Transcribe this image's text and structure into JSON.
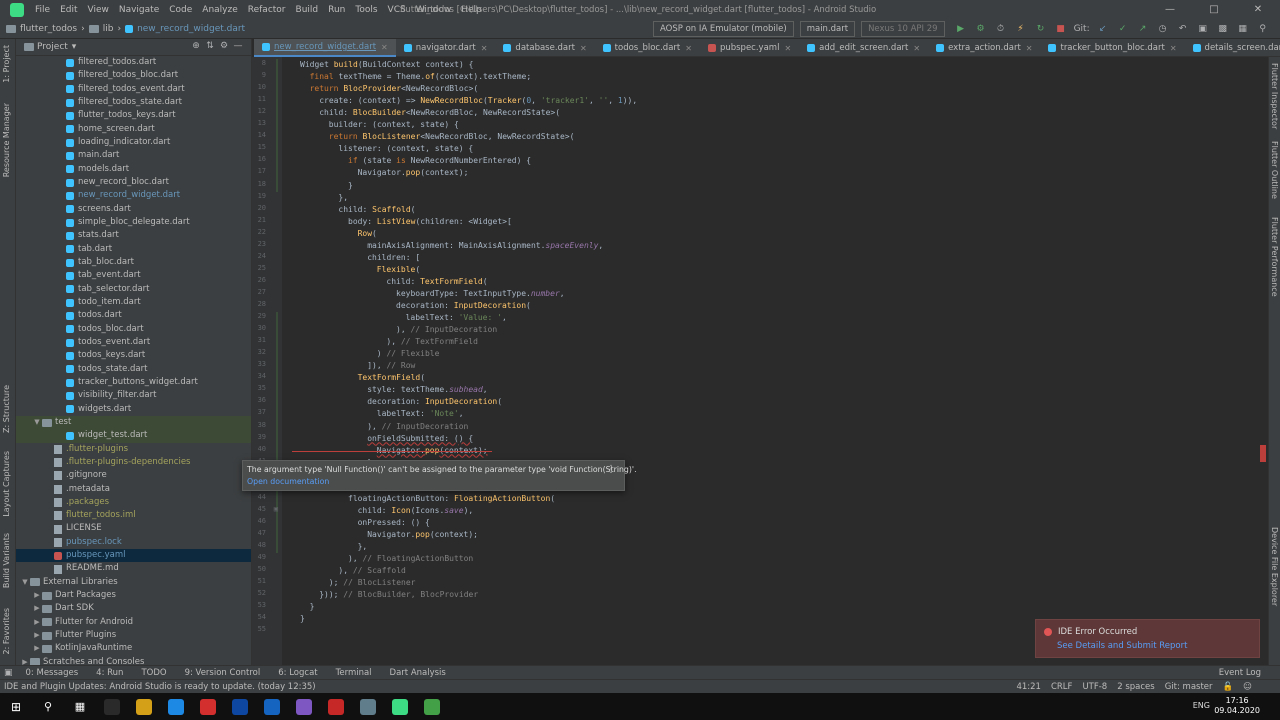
{
  "menubar": {
    "items": [
      "File",
      "Edit",
      "View",
      "Navigate",
      "Code",
      "Analyze",
      "Refactor",
      "Build",
      "Run",
      "Tools",
      "VCS",
      "Window",
      "Help"
    ],
    "title": "flutter_todos [C:\\Users\\PC\\Desktop\\flutter_todos] - ...\\lib\\new_record_widget.dart [flutter_todos] - Android Studio"
  },
  "navbar": {
    "crumbs": [
      "flutter_todos",
      "lib",
      "new_record_widget.dart"
    ],
    "device": "AOSP on IA Emulator (mobile)",
    "config": "main.dart",
    "avd": "Nexus 10 API 29",
    "git_label": "Git:"
  },
  "tabs": [
    {
      "label": "new_record_widget.dart",
      "active": true,
      "kind": "dart"
    },
    {
      "label": "navigator.dart",
      "active": false,
      "kind": "dart"
    },
    {
      "label": "database.dart",
      "active": false,
      "kind": "dart"
    },
    {
      "label": "todos_bloc.dart",
      "active": false,
      "kind": "dart"
    },
    {
      "label": "pubspec.yaml",
      "active": false,
      "kind": "yaml"
    },
    {
      "label": "add_edit_screen.dart",
      "active": false,
      "kind": "dart"
    },
    {
      "label": "extra_action.dart",
      "active": false,
      "kind": "dart"
    },
    {
      "label": "tracker_button_bloc.dart",
      "active": false,
      "kind": "dart"
    },
    {
      "label": "details_screen.dart",
      "active": false,
      "kind": "dart"
    }
  ],
  "project_panel": {
    "title": "Project",
    "tree": [
      {
        "label": "filtered_todos.dart",
        "indent": 3,
        "icon": "dart"
      },
      {
        "label": "filtered_todos_bloc.dart",
        "indent": 3,
        "icon": "dart"
      },
      {
        "label": "filtered_todos_event.dart",
        "indent": 3,
        "icon": "dart"
      },
      {
        "label": "filtered_todos_state.dart",
        "indent": 3,
        "icon": "dart"
      },
      {
        "label": "flutter_todos_keys.dart",
        "indent": 3,
        "icon": "dart"
      },
      {
        "label": "home_screen.dart",
        "indent": 3,
        "icon": "dart"
      },
      {
        "label": "loading_indicator.dart",
        "indent": 3,
        "icon": "dart"
      },
      {
        "label": "main.dart",
        "indent": 3,
        "icon": "dart"
      },
      {
        "label": "models.dart",
        "indent": 3,
        "icon": "dart"
      },
      {
        "label": "new_record_bloc.dart",
        "indent": 3,
        "icon": "dart"
      },
      {
        "label": "new_record_widget.dart",
        "indent": 3,
        "icon": "dart",
        "style": "blue"
      },
      {
        "label": "screens.dart",
        "indent": 3,
        "icon": "dart"
      },
      {
        "label": "simple_bloc_delegate.dart",
        "indent": 3,
        "icon": "dart"
      },
      {
        "label": "stats.dart",
        "indent": 3,
        "icon": "dart"
      },
      {
        "label": "tab.dart",
        "indent": 3,
        "icon": "dart"
      },
      {
        "label": "tab_bloc.dart",
        "indent": 3,
        "icon": "dart"
      },
      {
        "label": "tab_event.dart",
        "indent": 3,
        "icon": "dart"
      },
      {
        "label": "tab_selector.dart",
        "indent": 3,
        "icon": "dart"
      },
      {
        "label": "todo_item.dart",
        "indent": 3,
        "icon": "dart"
      },
      {
        "label": "todos.dart",
        "indent": 3,
        "icon": "dart"
      },
      {
        "label": "todos_bloc.dart",
        "indent": 3,
        "icon": "dart"
      },
      {
        "label": "todos_event.dart",
        "indent": 3,
        "icon": "dart"
      },
      {
        "label": "todos_keys.dart",
        "indent": 3,
        "icon": "dart"
      },
      {
        "label": "todos_state.dart",
        "indent": 3,
        "icon": "dart"
      },
      {
        "label": "tracker_buttons_widget.dart",
        "indent": 3,
        "icon": "dart"
      },
      {
        "label": "visibility_filter.dart",
        "indent": 3,
        "icon": "dart"
      },
      {
        "label": "widgets.dart",
        "indent": 3,
        "icon": "dart"
      },
      {
        "label": "test",
        "indent": 1,
        "icon": "folder",
        "arrow": "▼",
        "style": "test"
      },
      {
        "label": "widget_test.dart",
        "indent": 3,
        "icon": "dart",
        "style": "test"
      },
      {
        "label": ".flutter-plugins",
        "indent": 2,
        "icon": "file",
        "style": "olive"
      },
      {
        "label": ".flutter-plugins-dependencies",
        "indent": 2,
        "icon": "file",
        "style": "olive"
      },
      {
        "label": ".gitignore",
        "indent": 2,
        "icon": "file"
      },
      {
        "label": ".metadata",
        "indent": 2,
        "icon": "file"
      },
      {
        "label": ".packages",
        "indent": 2,
        "icon": "file",
        "style": "olive"
      },
      {
        "label": "flutter_todos.iml",
        "indent": 2,
        "icon": "file",
        "style": "olive"
      },
      {
        "label": "LICENSE",
        "indent": 2,
        "icon": "file"
      },
      {
        "label": "pubspec.lock",
        "indent": 2,
        "icon": "file",
        "style": "blue"
      },
      {
        "label": "pubspec.yaml",
        "indent": 2,
        "icon": "yaml",
        "style": "blue",
        "selected": true
      },
      {
        "label": "README.md",
        "indent": 2,
        "icon": "file"
      },
      {
        "label": "External Libraries",
        "indent": 0,
        "icon": "folder",
        "arrow": "▼"
      },
      {
        "label": "Dart Packages",
        "indent": 1,
        "icon": "folder",
        "arrow": "▶"
      },
      {
        "label": "Dart SDK",
        "indent": 1,
        "icon": "folder",
        "arrow": "▶"
      },
      {
        "label": "Flutter for Android",
        "indent": 1,
        "icon": "folder",
        "arrow": "▶"
      },
      {
        "label": "Flutter Plugins",
        "indent": 1,
        "icon": "folder",
        "arrow": "▶"
      },
      {
        "label": "KotlinJavaRuntime",
        "indent": 1,
        "icon": "folder",
        "arrow": "▶"
      },
      {
        "label": "Scratches and Consoles",
        "indent": 0,
        "icon": "folder",
        "arrow": "▶"
      }
    ]
  },
  "editor": {
    "lines": [
      {
        "n": "8",
        "i": 0,
        "t": [
          [
            "",
            "Widget "
          ],
          [
            "fn",
            "build"
          ],
          [
            "",
            "(BuildContext context) {"
          ]
        ]
      },
      {
        "n": "9",
        "i": 1,
        "t": [
          [
            "kw",
            "final "
          ],
          [
            "",
            "textTheme = Theme."
          ],
          [
            "fn",
            "of"
          ],
          [
            "",
            "(context).textTheme;"
          ]
        ]
      },
      {
        "n": "10",
        "i": 1,
        "t": [
          [
            "kw",
            "return "
          ],
          [
            "fn",
            "BlocProvider"
          ],
          [
            "",
            "<NewRecordBloc>("
          ]
        ]
      },
      {
        "n": "11",
        "i": 2,
        "t": [
          [
            "",
            "create: (context) => "
          ],
          [
            "fn",
            "NewRecordBloc"
          ],
          [
            "",
            "("
          ],
          [
            "fn",
            "Tracker"
          ],
          [
            "",
            "("
          ],
          [
            "nu",
            "0"
          ],
          [
            "",
            ", "
          ],
          [
            "st",
            "'tracker1'"
          ],
          [
            "",
            ", "
          ],
          [
            "st",
            "''"
          ],
          [
            "",
            ", "
          ],
          [
            "nu",
            "1"
          ],
          [
            "",
            "))"
          ],
          [
            "",
            ","
          ]
        ]
      },
      {
        "n": "12",
        "i": 2,
        "t": [
          [
            "",
            "child: "
          ],
          [
            "fn",
            "BlocBuilder"
          ],
          [
            "",
            "<NewRecordBloc, NewRecordState>("
          ]
        ]
      },
      {
        "n": "13",
        "i": 3,
        "t": [
          [
            "",
            "builder: (context, state) {"
          ]
        ]
      },
      {
        "n": "14",
        "i": 3,
        "t": [
          [
            "kw",
            "return "
          ],
          [
            "fn",
            "BlocListener"
          ],
          [
            "",
            "<NewRecordBloc, NewRecordState>("
          ]
        ]
      },
      {
        "n": "15",
        "i": 4,
        "t": [
          [
            "",
            "listener: (context, state) {"
          ]
        ]
      },
      {
        "n": "16",
        "i": 5,
        "t": [
          [
            "kw",
            "if "
          ],
          [
            "",
            "(state "
          ],
          [
            "kw",
            "is "
          ],
          [
            "",
            "NewRecordNumberEntered) {"
          ]
        ]
      },
      {
        "n": "17",
        "i": 6,
        "t": [
          [
            "",
            "Navigator."
          ],
          [
            "fn",
            "pop"
          ],
          [
            "",
            "(context);"
          ]
        ]
      },
      {
        "n": "18",
        "i": 5,
        "t": [
          [
            "",
            "}"
          ]
        ]
      },
      {
        "n": "19",
        "i": 4,
        "t": [
          [
            "",
            "},"
          ]
        ]
      },
      {
        "n": "20",
        "i": 4,
        "t": [
          [
            "",
            "child: "
          ],
          [
            "fn",
            "Scaffold"
          ],
          [
            "",
            "("
          ]
        ]
      },
      {
        "n": "21",
        "i": 5,
        "t": [
          [
            "",
            "body: "
          ],
          [
            "fn",
            "ListView"
          ],
          [
            "",
            "(children: <Widget>["
          ]
        ]
      },
      {
        "n": "22",
        "i": 6,
        "t": [
          [
            "fn",
            "Row"
          ],
          [
            "",
            "("
          ]
        ]
      },
      {
        "n": "23",
        "i": 7,
        "t": [
          [
            "",
            "mainAxisAlignment: MainAxisAlignment."
          ],
          [
            "pr",
            "spaceEvenly"
          ],
          [
            "",
            ","
          ]
        ]
      },
      {
        "n": "24",
        "i": 7,
        "t": [
          [
            "",
            "children: ["
          ]
        ]
      },
      {
        "n": "25",
        "i": 8,
        "t": [
          [
            "fn",
            "Flexible"
          ],
          [
            "",
            "("
          ]
        ]
      },
      {
        "n": "26",
        "i": 9,
        "t": [
          [
            "",
            "child: "
          ],
          [
            "fn",
            "TextFormField"
          ],
          [
            "",
            "("
          ]
        ]
      },
      {
        "n": "27",
        "i": 10,
        "t": [
          [
            "",
            "keyboardType: TextInputType."
          ],
          [
            "pr",
            "number"
          ],
          [
            "",
            ","
          ]
        ]
      },
      {
        "n": "28",
        "i": 10,
        "t": [
          [
            "",
            "decoration: "
          ],
          [
            "fn",
            "InputDecoration"
          ],
          [
            "",
            "("
          ]
        ]
      },
      {
        "n": "29",
        "i": 11,
        "t": [
          [
            "",
            "labelText: "
          ],
          [
            "st",
            "'Value: '"
          ],
          [
            "",
            ","
          ]
        ]
      },
      {
        "n": "30",
        "i": 10,
        "t": [
          [
            "",
            "), "
          ],
          [
            "cm",
            "// InputDecoration"
          ]
        ]
      },
      {
        "n": "31",
        "i": 9,
        "t": [
          [
            "",
            "), "
          ],
          [
            "cm",
            "// TextFormField"
          ]
        ]
      },
      {
        "n": "32",
        "i": 8,
        "t": [
          [
            "",
            ") "
          ],
          [
            "cm",
            "// Flexible"
          ]
        ]
      },
      {
        "n": "33",
        "i": 7,
        "t": [
          [
            "",
            "]), "
          ],
          [
            "cm",
            "// Row"
          ]
        ]
      },
      {
        "n": "34",
        "i": 6,
        "t": [
          [
            "fn",
            "TextFormField"
          ],
          [
            "",
            "("
          ]
        ]
      },
      {
        "n": "35",
        "i": 7,
        "t": [
          [
            "",
            "style: textTheme."
          ],
          [
            "pr",
            "subhead"
          ],
          [
            "",
            ","
          ]
        ]
      },
      {
        "n": "36",
        "i": 7,
        "t": [
          [
            "",
            "decoration: "
          ],
          [
            "fn",
            "InputDecoration"
          ],
          [
            "",
            "("
          ]
        ]
      },
      {
        "n": "37",
        "i": 8,
        "t": [
          [
            "",
            "labelText: "
          ],
          [
            "st",
            "'Note'"
          ],
          [
            "",
            ","
          ]
        ]
      },
      {
        "n": "38",
        "i": 7,
        "t": [
          [
            "",
            "), "
          ],
          [
            "cm",
            "// InputDecoration"
          ]
        ]
      },
      {
        "n": "39",
        "i": 7,
        "t": [
          [
            "err",
            "onFieldSubmitted: () {"
          ]
        ]
      },
      {
        "n": "40",
        "i": 8,
        "t": [
          [
            "err",
            "Navigator."
          ],
          [
            "fn",
            "pop"
          ],
          [
            "err",
            "(context);"
          ]
        ]
      },
      {
        "n": "41",
        "i": 7,
        "t": [
          [
            "",
            "},"
          ]
        ]
      },
      {
        "n": "44",
        "i": 5,
        "t": [
          [
            "",
            "floatingActionButton: "
          ],
          [
            "fn",
            "FloatingActionButton"
          ],
          [
            "",
            "("
          ]
        ]
      },
      {
        "n": "45",
        "i": 6,
        "t": [
          [
            "",
            "child: "
          ],
          [
            "fn",
            "Icon"
          ],
          [
            "",
            "(Icons."
          ],
          [
            "pr",
            "save"
          ],
          [
            "",
            "),"
          ]
        ]
      },
      {
        "n": "46",
        "i": 6,
        "t": [
          [
            "",
            "onPressed: () {"
          ]
        ]
      },
      {
        "n": "47",
        "i": 7,
        "t": [
          [
            "",
            "Navigator."
          ],
          [
            "fn",
            "pop"
          ],
          [
            "",
            "(context);"
          ]
        ]
      },
      {
        "n": "48",
        "i": 6,
        "t": [
          [
            "",
            "},"
          ]
        ]
      },
      {
        "n": "49",
        "i": 5,
        "t": [
          [
            "",
            "), "
          ],
          [
            "cm",
            "// FloatingActionButton"
          ]
        ]
      },
      {
        "n": "50",
        "i": 4,
        "t": [
          [
            "",
            "), "
          ],
          [
            "cm",
            "// Scaffold"
          ]
        ]
      },
      {
        "n": "51",
        "i": 3,
        "t": [
          [
            "",
            "); "
          ],
          [
            "cm",
            "// BlocListener"
          ]
        ]
      },
      {
        "n": "52",
        "i": 2,
        "t": [
          [
            "",
            "})); "
          ],
          [
            "cm",
            "// BlocBuilder, BlocProvider"
          ]
        ]
      },
      {
        "n": "53",
        "i": 1,
        "t": [
          [
            "",
            "}"
          ]
        ]
      },
      {
        "n": "54",
        "i": 0,
        "t": [
          [
            "",
            "}"
          ]
        ]
      },
      {
        "n": "55",
        "i": 0,
        "t": []
      }
    ]
  },
  "tooltip": {
    "message": "The argument type 'Null Function()' can't be assigned to the parameter type 'void Function(String)'.",
    "link": "Open documentation"
  },
  "notification": {
    "title": "IDE Error Occurred",
    "link": "See Details and Submit Report"
  },
  "toolwindows": [
    "0: Messages",
    "4: Run",
    "TODO",
    "9: Version Control",
    "6: Logcat",
    "Terminal",
    "Dart Analysis"
  ],
  "event_log": "Event Log",
  "left_strip": [
    "1: Project",
    "Resource Manager",
    "Z: Structure",
    "Layout Captures",
    "Build Variants",
    "2: Favorites"
  ],
  "right_strip": [
    "Flutter Inspector",
    "Flutter Outline",
    "Flutter Performance",
    "Device File Explorer"
  ],
  "status": {
    "message": "IDE and Plugin Updates: Android Studio is ready to update. (today 12:35)",
    "position": "41:21",
    "line_sep": "CRLF",
    "encoding": "UTF-8",
    "indent": "2 spaces",
    "git": "Git: master"
  },
  "taskbar": {
    "time": "17:16",
    "date": "09.04.2020",
    "lang": "ENG",
    "apps": [
      "#2a2a2a",
      "#d4a017",
      "#1e88e5",
      "#d32f2f",
      "#0d47a1",
      "#1565c0",
      "#7e57c2",
      "#c62828",
      "#607d8b",
      "#3ddc84",
      "#43a047"
    ]
  }
}
